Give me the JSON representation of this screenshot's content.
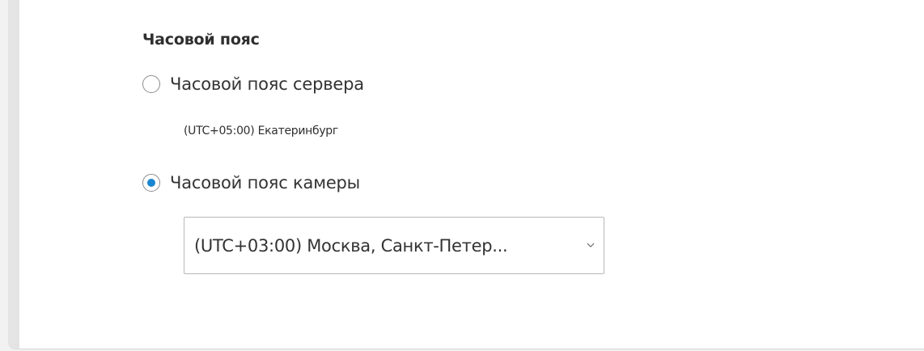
{
  "timezone_section": {
    "title": "Часовой пояс",
    "server_option": {
      "label": "Часовой пояс сервера",
      "selected": false,
      "info": "(UTC+05:00) Екатеринбург"
    },
    "camera_option": {
      "label": "Часовой пояс камеры",
      "selected": true
    },
    "camera_timezone_select": {
      "value": "(UTC+03:00) Москва, Санкт-Петер..."
    }
  },
  "icons": {
    "dropdown": "chevron-down-icon"
  },
  "colors": {
    "accent": "#1a86d0",
    "panel_background": "#ffffff",
    "side_border": "#e4e4e4"
  }
}
